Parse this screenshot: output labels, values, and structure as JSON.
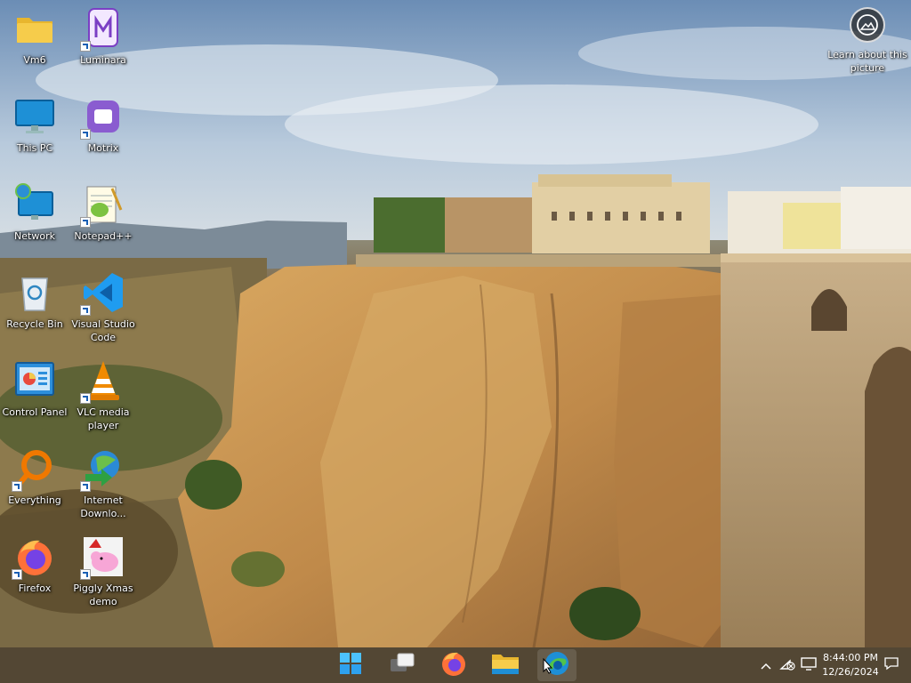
{
  "desktop": {
    "icons": [
      {
        "label": "Vm6",
        "icon": "folder-icon"
      },
      {
        "label": "Luminara",
        "icon": "luminara-icon"
      },
      {
        "label": "This PC",
        "icon": "monitor-icon"
      },
      {
        "label": "Motrix",
        "icon": "motrix-icon"
      },
      {
        "label": "Network",
        "icon": "network-icon"
      },
      {
        "label": "Notepad++",
        "icon": "notepadpp-icon"
      },
      {
        "label": "Recycle Bin",
        "icon": "recycle-bin-icon"
      },
      {
        "label": "Visual Studio Code",
        "icon": "vscode-icon"
      },
      {
        "label": "Control Panel",
        "icon": "control-panel-icon"
      },
      {
        "label": "VLC media player",
        "icon": "vlc-icon"
      },
      {
        "label": "Everything",
        "icon": "everything-icon"
      },
      {
        "label": "Internet Downlo...",
        "icon": "idm-icon"
      },
      {
        "label": "Firefox",
        "icon": "firefox-icon"
      },
      {
        "label": "Piggly Xmas demo",
        "icon": "piggly-icon"
      }
    ],
    "learn_label": "Learn about this picture"
  },
  "taskbar": {
    "apps": [
      {
        "name": "Start",
        "icon": "windows-start-icon"
      },
      {
        "name": "Task View",
        "icon": "task-view-icon"
      },
      {
        "name": "Firefox",
        "icon": "firefox-icon"
      },
      {
        "name": "File Explorer",
        "icon": "file-explorer-icon"
      },
      {
        "name": "Microsoft Edge",
        "icon": "edge-icon"
      }
    ],
    "time": "8:44:00 PM",
    "date": "12/26/2024"
  },
  "colors": {
    "taskbar": "#4c402c",
    "accent": "#0078d4"
  }
}
